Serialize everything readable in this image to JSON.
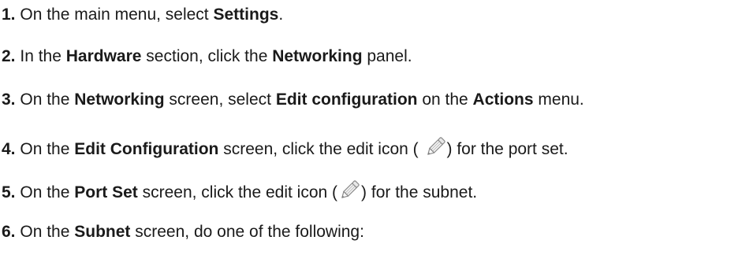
{
  "steps": [
    {
      "number": "1.",
      "parts": [
        "On the main menu, select ",
        "Settings",
        "."
      ]
    },
    {
      "number": "2.",
      "parts": [
        "In the ",
        "Hardware",
        " section, click the ",
        "Networking",
        " panel."
      ]
    },
    {
      "number": "3.",
      "parts": [
        "On the ",
        "Networking",
        " screen, select ",
        "Edit configuration",
        " on the ",
        "Actions",
        " menu."
      ]
    },
    {
      "number": "4.",
      "parts": [
        "On the ",
        "Edit Configuration",
        " screen, click the edit icon ( ",
        ") for the port set."
      ],
      "icon": "pencil-edit-icon"
    },
    {
      "number": "5.",
      "parts": [
        "On the ",
        "Port Set",
        " screen, click the edit icon (",
        ") for the subnet."
      ],
      "icon": "pencil-edit-icon"
    },
    {
      "number": "6.",
      "parts": [
        "On the ",
        "Subnet",
        " screen, do one of the following:"
      ]
    }
  ]
}
